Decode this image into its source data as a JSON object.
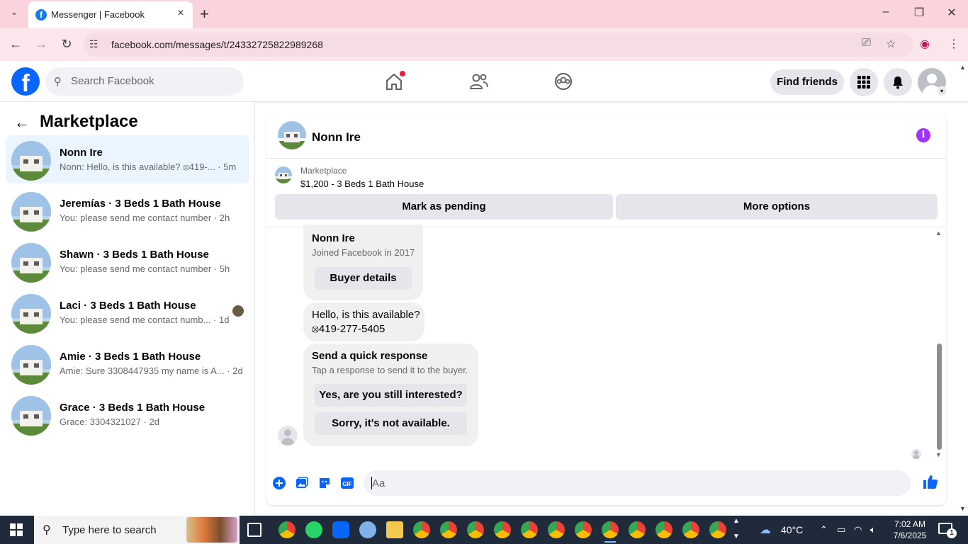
{
  "browser": {
    "tab_title": "Messenger | Facebook",
    "tab_close": "×",
    "new_tab": "+",
    "url": "facebook.com/messages/t/24332725822989268",
    "minimize": "–",
    "maximize": "❐",
    "close": "✕",
    "back": "←",
    "forward": "→",
    "reload": "↻"
  },
  "fb_header": {
    "logo": "f",
    "search_placeholder": "Search Facebook",
    "find_friends": "Find friends"
  },
  "sidebar": {
    "title": "Marketplace",
    "conversations": [
      {
        "name": "Nonn Ire",
        "preview": "Nonn: Hello, is this available? ⦻419-... · 5m",
        "active": true
      },
      {
        "name": "Jeremías · 3 Beds 1 Bath House",
        "preview": "You: please send me contact number · 2h"
      },
      {
        "name": "Shawn · 3 Beds 1 Bath House",
        "preview": "You: please send me contact number · 5h"
      },
      {
        "name": "Laci · 3 Beds 1 Bath House",
        "preview": "You: please send me contact numb... · 1d"
      },
      {
        "name": "Amie · 3 Beds 1 Bath House",
        "preview": "Amie: Sure 3308447935 my name is A... · 2d"
      },
      {
        "name": "Grace · 3 Beds 1 Bath House",
        "preview": "Grace: 3304321027 · 2d"
      }
    ]
  },
  "chat": {
    "contact_name": "Nonn Ire",
    "info_icon_label": "i",
    "listing_category": "Marketplace",
    "listing_title": "$1,200 - 3 Beds 1 Bath House",
    "mark_pending": "Mark as pending",
    "more_options": "More options",
    "profile_card": {
      "name": "Nonn Ire",
      "joined": "Joined Facebook in 2017",
      "buyer_details": "Buyer details"
    },
    "message": {
      "line1": "Hello, is this available?",
      "line2": "⦻419-277-5405"
    },
    "quick_response": {
      "title": "Send a quick response",
      "subtitle": "Tap a response to send it to the buyer.",
      "option1": "Yes, are you still interested?",
      "option2": "Sorry, it's not available."
    },
    "composer_placeholder": "Aa"
  },
  "taskbar": {
    "search_placeholder": "Type here to search",
    "weather": "40°C",
    "time": "7:02 AM",
    "date": "7/6/2025",
    "notification_count": "1"
  },
  "colors": {
    "facebook_blue": "#0866ff",
    "active_conversation": "#ebf5ff",
    "tab_bar_pink": "#fbd3dc",
    "info_purple": "#a033ff"
  }
}
